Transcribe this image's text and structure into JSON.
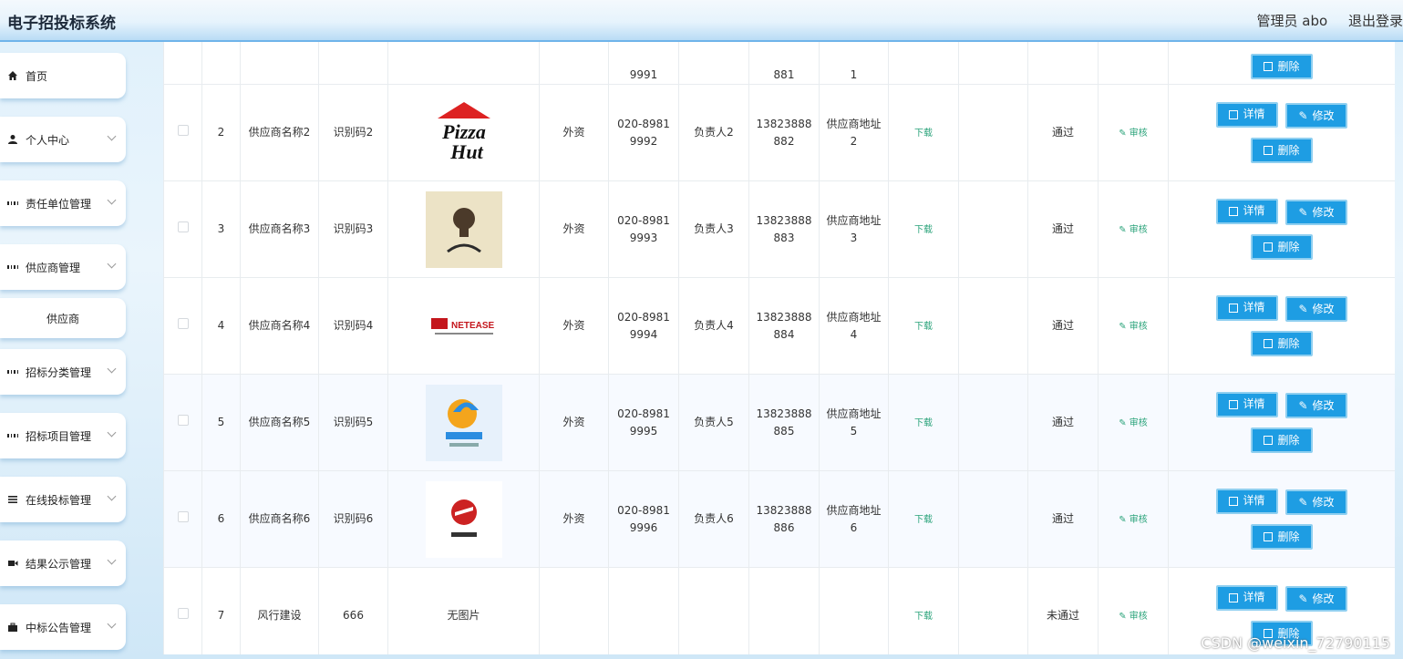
{
  "header": {
    "title": "电子招投标系统",
    "user": "管理员 abo",
    "logout": "退出登录"
  },
  "sidebar": {
    "items": [
      {
        "label": "首页",
        "icon": "home-icon"
      },
      {
        "label": "个人中心",
        "icon": "user-icon"
      },
      {
        "label": "责任单位管理",
        "icon": "grid-icon"
      },
      {
        "label": "供应商管理",
        "icon": "grid-icon"
      },
      {
        "label": "供应商",
        "icon": ""
      },
      {
        "label": "招标分类管理",
        "icon": "grid-icon"
      },
      {
        "label": "招标项目管理",
        "icon": "grid-icon"
      },
      {
        "label": "在线投标管理",
        "icon": "list-icon"
      },
      {
        "label": "结果公示管理",
        "icon": "video-icon"
      },
      {
        "label": "中标公告管理",
        "icon": "briefcase-icon"
      }
    ]
  },
  "table": {
    "partial_row": {
      "phone_tail": "9991",
      "mobile_tail": "881",
      "addr_tail": "1"
    },
    "rows": [
      {
        "index": "2",
        "name": "供应商名称2",
        "code": "识别码2",
        "logo": "pizza-hut-logo",
        "nature": "外资",
        "phone": "020-8981 9992",
        "contact": "负责人2",
        "mobile": "13823888 882",
        "address": "供应商地址 2",
        "download": "下载",
        "status": "通过",
        "audit": "审核"
      },
      {
        "index": "3",
        "name": "供应商名称3",
        "code": "识别码3",
        "logo": "zhonggulou-logo",
        "nature": "外资",
        "phone": "020-8981 9993",
        "contact": "负责人3",
        "mobile": "13823888 883",
        "address": "供应商地址 3",
        "download": "下载",
        "status": "通过",
        "audit": "审核"
      },
      {
        "index": "4",
        "name": "供应商名称4",
        "code": "识别码4",
        "logo": "netease-logo",
        "nature": "外资",
        "phone": "020-8981 9994",
        "contact": "负责人4",
        "mobile": "13823888 884",
        "address": "供应商地址 4",
        "download": "下载",
        "status": "通过",
        "audit": "审核"
      },
      {
        "index": "5",
        "name": "供应商名称5",
        "code": "识别码5",
        "logo": "tencent-games-logo",
        "nature": "外资",
        "phone": "020-8981 9995",
        "contact": "负责人5",
        "mobile": "13823888 885",
        "address": "供应商地址 5",
        "download": "下载",
        "status": "通过",
        "audit": "审核"
      },
      {
        "index": "6",
        "name": "供应商名称6",
        "code": "识别码6",
        "logo": "tongxin-logo",
        "nature": "外资",
        "phone": "020-8981 9996",
        "contact": "负责人6",
        "mobile": "13823888 886",
        "address": "供应商地址 6",
        "download": "下载",
        "status": "通过",
        "audit": "审核"
      },
      {
        "index": "7",
        "name": "风行建设",
        "code": "666",
        "logo": "",
        "no_image": "无图片",
        "nature": "",
        "phone": "",
        "contact": "",
        "mobile": "",
        "address": "",
        "download": "下载",
        "status": "未通过",
        "audit": "审核"
      }
    ],
    "buttons": {
      "detail": "详情",
      "edit": "修改",
      "delete": "删除"
    }
  },
  "watermark": "CSDN @weixin_72790115",
  "colors": {
    "primary_button": "#1e9de3",
    "link_green": "#2aa37a",
    "header_bg": "#e6f3fc"
  }
}
